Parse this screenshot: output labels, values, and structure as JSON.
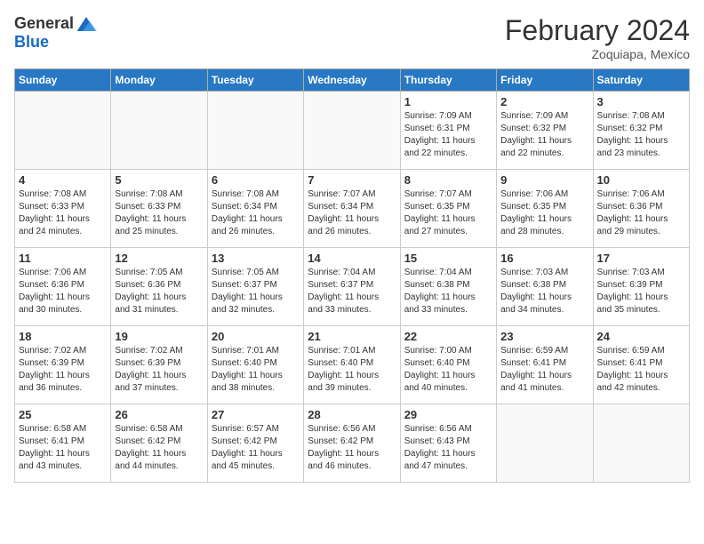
{
  "header": {
    "logo_general": "General",
    "logo_blue": "Blue",
    "month_title": "February 2024",
    "location": "Zoquiapa, Mexico"
  },
  "days_of_week": [
    "Sunday",
    "Monday",
    "Tuesday",
    "Wednesday",
    "Thursday",
    "Friday",
    "Saturday"
  ],
  "weeks": [
    [
      {
        "day": "",
        "info": ""
      },
      {
        "day": "",
        "info": ""
      },
      {
        "day": "",
        "info": ""
      },
      {
        "day": "",
        "info": ""
      },
      {
        "day": "1",
        "info": "Sunrise: 7:09 AM\nSunset: 6:31 PM\nDaylight: 11 hours\nand 22 minutes."
      },
      {
        "day": "2",
        "info": "Sunrise: 7:09 AM\nSunset: 6:32 PM\nDaylight: 11 hours\nand 22 minutes."
      },
      {
        "day": "3",
        "info": "Sunrise: 7:08 AM\nSunset: 6:32 PM\nDaylight: 11 hours\nand 23 minutes."
      }
    ],
    [
      {
        "day": "4",
        "info": "Sunrise: 7:08 AM\nSunset: 6:33 PM\nDaylight: 11 hours\nand 24 minutes."
      },
      {
        "day": "5",
        "info": "Sunrise: 7:08 AM\nSunset: 6:33 PM\nDaylight: 11 hours\nand 25 minutes."
      },
      {
        "day": "6",
        "info": "Sunrise: 7:08 AM\nSunset: 6:34 PM\nDaylight: 11 hours\nand 26 minutes."
      },
      {
        "day": "7",
        "info": "Sunrise: 7:07 AM\nSunset: 6:34 PM\nDaylight: 11 hours\nand 26 minutes."
      },
      {
        "day": "8",
        "info": "Sunrise: 7:07 AM\nSunset: 6:35 PM\nDaylight: 11 hours\nand 27 minutes."
      },
      {
        "day": "9",
        "info": "Sunrise: 7:06 AM\nSunset: 6:35 PM\nDaylight: 11 hours\nand 28 minutes."
      },
      {
        "day": "10",
        "info": "Sunrise: 7:06 AM\nSunset: 6:36 PM\nDaylight: 11 hours\nand 29 minutes."
      }
    ],
    [
      {
        "day": "11",
        "info": "Sunrise: 7:06 AM\nSunset: 6:36 PM\nDaylight: 11 hours\nand 30 minutes."
      },
      {
        "day": "12",
        "info": "Sunrise: 7:05 AM\nSunset: 6:36 PM\nDaylight: 11 hours\nand 31 minutes."
      },
      {
        "day": "13",
        "info": "Sunrise: 7:05 AM\nSunset: 6:37 PM\nDaylight: 11 hours\nand 32 minutes."
      },
      {
        "day": "14",
        "info": "Sunrise: 7:04 AM\nSunset: 6:37 PM\nDaylight: 11 hours\nand 33 minutes."
      },
      {
        "day": "15",
        "info": "Sunrise: 7:04 AM\nSunset: 6:38 PM\nDaylight: 11 hours\nand 33 minutes."
      },
      {
        "day": "16",
        "info": "Sunrise: 7:03 AM\nSunset: 6:38 PM\nDaylight: 11 hours\nand 34 minutes."
      },
      {
        "day": "17",
        "info": "Sunrise: 7:03 AM\nSunset: 6:39 PM\nDaylight: 11 hours\nand 35 minutes."
      }
    ],
    [
      {
        "day": "18",
        "info": "Sunrise: 7:02 AM\nSunset: 6:39 PM\nDaylight: 11 hours\nand 36 minutes."
      },
      {
        "day": "19",
        "info": "Sunrise: 7:02 AM\nSunset: 6:39 PM\nDaylight: 11 hours\nand 37 minutes."
      },
      {
        "day": "20",
        "info": "Sunrise: 7:01 AM\nSunset: 6:40 PM\nDaylight: 11 hours\nand 38 minutes."
      },
      {
        "day": "21",
        "info": "Sunrise: 7:01 AM\nSunset: 6:40 PM\nDaylight: 11 hours\nand 39 minutes."
      },
      {
        "day": "22",
        "info": "Sunrise: 7:00 AM\nSunset: 6:40 PM\nDaylight: 11 hours\nand 40 minutes."
      },
      {
        "day": "23",
        "info": "Sunrise: 6:59 AM\nSunset: 6:41 PM\nDaylight: 11 hours\nand 41 minutes."
      },
      {
        "day": "24",
        "info": "Sunrise: 6:59 AM\nSunset: 6:41 PM\nDaylight: 11 hours\nand 42 minutes."
      }
    ],
    [
      {
        "day": "25",
        "info": "Sunrise: 6:58 AM\nSunset: 6:41 PM\nDaylight: 11 hours\nand 43 minutes."
      },
      {
        "day": "26",
        "info": "Sunrise: 6:58 AM\nSunset: 6:42 PM\nDaylight: 11 hours\nand 44 minutes."
      },
      {
        "day": "27",
        "info": "Sunrise: 6:57 AM\nSunset: 6:42 PM\nDaylight: 11 hours\nand 45 minutes."
      },
      {
        "day": "28",
        "info": "Sunrise: 6:56 AM\nSunset: 6:42 PM\nDaylight: 11 hours\nand 46 minutes."
      },
      {
        "day": "29",
        "info": "Sunrise: 6:56 AM\nSunset: 6:43 PM\nDaylight: 11 hours\nand 47 minutes."
      },
      {
        "day": "",
        "info": ""
      },
      {
        "day": "",
        "info": ""
      }
    ]
  ]
}
